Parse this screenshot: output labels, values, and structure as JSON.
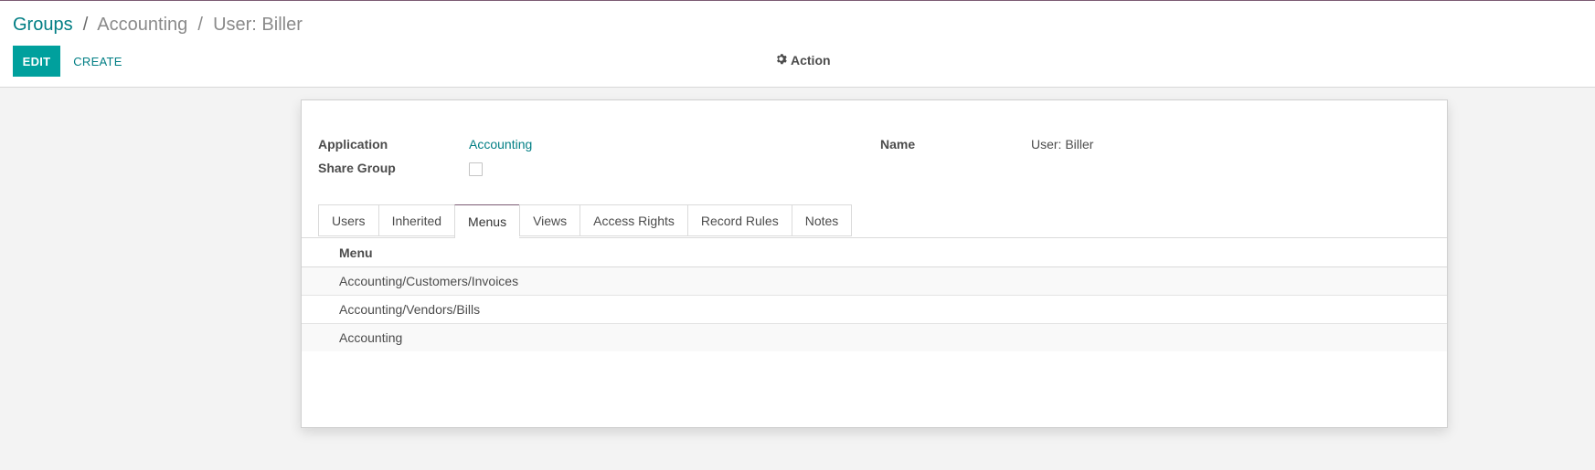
{
  "breadcrumb": {
    "root": "Groups",
    "sep1": "/",
    "app": "Accounting",
    "sep2": "/",
    "current": "User: Biller"
  },
  "toolbar": {
    "edit_label": "EDIT",
    "create_label": "CREATE",
    "action_label": "Action",
    "action_icon": "gear-icon"
  },
  "form": {
    "application_label": "Application",
    "application_value": "Accounting",
    "share_group_label": "Share Group",
    "share_group_checked": false,
    "name_label": "Name",
    "name_value": "User: Biller"
  },
  "tabs": [
    {
      "label": "Users"
    },
    {
      "label": "Inherited"
    },
    {
      "label": "Menus",
      "active": true
    },
    {
      "label": "Views"
    },
    {
      "label": "Access Rights"
    },
    {
      "label": "Record Rules"
    },
    {
      "label": "Notes"
    }
  ],
  "menus_table": {
    "header": "Menu",
    "rows": [
      "Accounting/Customers/Invoices",
      "Accounting/Vendors/Bills",
      "Accounting"
    ]
  },
  "colors": {
    "primary": "#00a09d",
    "link": "#017e84",
    "accent": "#7c5b73"
  }
}
